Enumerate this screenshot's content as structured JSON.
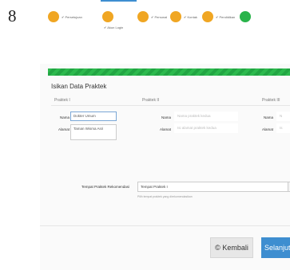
{
  "page_number": "8",
  "steps": [
    {
      "label": "✔ Persetujuan",
      "status": "pending",
      "color": "#f0a623"
    },
    {
      "label": "✔ Akun Login",
      "status": "pending",
      "color": "#f0a623"
    },
    {
      "label": "✔ Personal",
      "status": "pending",
      "color": "#f0a623"
    },
    {
      "label": "✔ Kontak",
      "status": "pending",
      "color": "#f0a623"
    },
    {
      "label": "✔ Pendidikan",
      "status": "pending",
      "color": "#f0a623"
    },
    {
      "label": "",
      "status": "active",
      "color": "#29b34a"
    }
  ],
  "progress_color": "#2dba4e",
  "form": {
    "title": "Isikan Data Praktek",
    "practice1": {
      "heading": "Praktek I",
      "name_label": "Nama",
      "name_value": "Dokter Umum",
      "address_label": "Alamat",
      "address_value": "Taman Wisma Asri"
    },
    "practice2": {
      "heading": "Praktek II",
      "name_label": "Nama",
      "name_placeholder": "Nama praktek kedua",
      "address_label": "Alamat",
      "address_placeholder": "Isi alamat praktek kedua"
    },
    "practice3": {
      "heading": "Praktek III",
      "name_label": "Nama",
      "name_placeholder": "N",
      "address_label": "Alamat",
      "address_placeholder": "Is"
    },
    "recommended": {
      "label": "Tempat Praktek Rekomendasi",
      "selected": "Tempat Praktek I",
      "help": "Pilih tempat praktek yang direkomendasikan"
    }
  },
  "footer": {
    "back_label": "Kembali",
    "next_label": "Selanjut",
    "accent": "#3e8ed0"
  }
}
